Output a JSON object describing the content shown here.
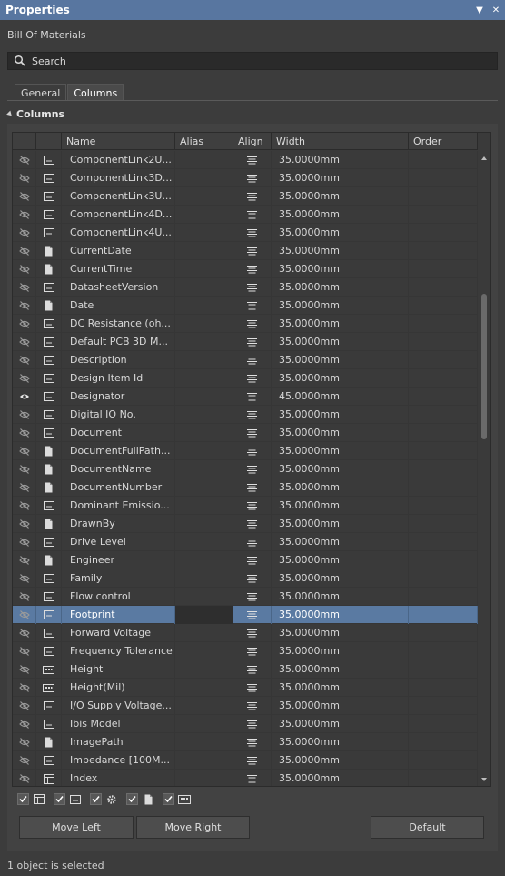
{
  "window": {
    "title": "Properties",
    "pin_glyph": "▼",
    "close_glyph": "✕"
  },
  "subject": "Bill Of Materials",
  "search": {
    "placeholder": "Search",
    "value": ""
  },
  "tabs": [
    {
      "label": "General",
      "active": false
    },
    {
      "label": "Columns",
      "active": true
    }
  ],
  "section": {
    "label": "Columns"
  },
  "table": {
    "headers": {
      "visible": "",
      "type": "",
      "name": "Name",
      "alias": "Alias",
      "align": "Align",
      "width": "Width",
      "order": "Order"
    },
    "rows": [
      {
        "name": "ComponentLink2U...",
        "alias": "",
        "width": "35.0000mm",
        "order": "",
        "visible": false,
        "type": "param",
        "selected": false
      },
      {
        "name": "ComponentLink3D...",
        "alias": "",
        "width": "35.0000mm",
        "order": "",
        "visible": false,
        "type": "param",
        "selected": false
      },
      {
        "name": "ComponentLink3U...",
        "alias": "",
        "width": "35.0000mm",
        "order": "",
        "visible": false,
        "type": "param",
        "selected": false
      },
      {
        "name": "ComponentLink4D...",
        "alias": "",
        "width": "35.0000mm",
        "order": "",
        "visible": false,
        "type": "param",
        "selected": false
      },
      {
        "name": "ComponentLink4U...",
        "alias": "",
        "width": "35.0000mm",
        "order": "",
        "visible": false,
        "type": "param",
        "selected": false
      },
      {
        "name": "CurrentDate",
        "alias": "",
        "width": "35.0000mm",
        "order": "",
        "visible": false,
        "type": "doc",
        "selected": false
      },
      {
        "name": "CurrentTime",
        "alias": "",
        "width": "35.0000mm",
        "order": "",
        "visible": false,
        "type": "doc",
        "selected": false
      },
      {
        "name": "DatasheetVersion",
        "alias": "",
        "width": "35.0000mm",
        "order": "",
        "visible": false,
        "type": "param",
        "selected": false
      },
      {
        "name": "Date",
        "alias": "",
        "width": "35.0000mm",
        "order": "",
        "visible": false,
        "type": "doc",
        "selected": false
      },
      {
        "name": "DC Resistance (oh...",
        "alias": "",
        "width": "35.0000mm",
        "order": "",
        "visible": false,
        "type": "param",
        "selected": false
      },
      {
        "name": "Default PCB 3D M...",
        "alias": "",
        "width": "35.0000mm",
        "order": "",
        "visible": false,
        "type": "param",
        "selected": false
      },
      {
        "name": "Description",
        "alias": "",
        "width": "35.0000mm",
        "order": "",
        "visible": false,
        "type": "param",
        "selected": false
      },
      {
        "name": "Design Item Id",
        "alias": "",
        "width": "35.0000mm",
        "order": "",
        "visible": false,
        "type": "param",
        "selected": false
      },
      {
        "name": "Designator",
        "alias": "",
        "width": "45.0000mm",
        "order": "",
        "visible": true,
        "type": "param",
        "selected": false
      },
      {
        "name": "Digital IO No.",
        "alias": "",
        "width": "35.0000mm",
        "order": "",
        "visible": false,
        "type": "param",
        "selected": false
      },
      {
        "name": "Document",
        "alias": "",
        "width": "35.0000mm",
        "order": "",
        "visible": false,
        "type": "param",
        "selected": false
      },
      {
        "name": "DocumentFullPath...",
        "alias": "",
        "width": "35.0000mm",
        "order": "",
        "visible": false,
        "type": "doc",
        "selected": false
      },
      {
        "name": "DocumentName",
        "alias": "",
        "width": "35.0000mm",
        "order": "",
        "visible": false,
        "type": "doc",
        "selected": false
      },
      {
        "name": "DocumentNumber",
        "alias": "",
        "width": "35.0000mm",
        "order": "",
        "visible": false,
        "type": "doc",
        "selected": false
      },
      {
        "name": "Dominant Emissio...",
        "alias": "",
        "width": "35.0000mm",
        "order": "",
        "visible": false,
        "type": "param",
        "selected": false
      },
      {
        "name": "DrawnBy",
        "alias": "",
        "width": "35.0000mm",
        "order": "",
        "visible": false,
        "type": "doc",
        "selected": false
      },
      {
        "name": "Drive Level",
        "alias": "",
        "width": "35.0000mm",
        "order": "",
        "visible": false,
        "type": "param",
        "selected": false
      },
      {
        "name": "Engineer",
        "alias": "",
        "width": "35.0000mm",
        "order": "",
        "visible": false,
        "type": "doc",
        "selected": false
      },
      {
        "name": "Family",
        "alias": "",
        "width": "35.0000mm",
        "order": "",
        "visible": false,
        "type": "param",
        "selected": false
      },
      {
        "name": "Flow control",
        "alias": "",
        "width": "35.0000mm",
        "order": "",
        "visible": false,
        "type": "param",
        "selected": false
      },
      {
        "name": "Footprint",
        "alias": "",
        "width": "35.0000mm",
        "order": "",
        "visible": false,
        "type": "param",
        "selected": true
      },
      {
        "name": "Forward Voltage",
        "alias": "",
        "width": "35.0000mm",
        "order": "",
        "visible": false,
        "type": "param",
        "selected": false
      },
      {
        "name": "Frequency Tolerance",
        "alias": "",
        "width": "35.0000mm",
        "order": "",
        "visible": false,
        "type": "param",
        "selected": false
      },
      {
        "name": "Height",
        "alias": "",
        "width": "35.0000mm",
        "order": "",
        "visible": false,
        "type": "pcb",
        "selected": false
      },
      {
        "name": "Height(Mil)",
        "alias": "",
        "width": "35.0000mm",
        "order": "",
        "visible": false,
        "type": "pcb",
        "selected": false
      },
      {
        "name": "I/O Supply Voltage...",
        "alias": "",
        "width": "35.0000mm",
        "order": "",
        "visible": false,
        "type": "param",
        "selected": false
      },
      {
        "name": "Ibis Model",
        "alias": "",
        "width": "35.0000mm",
        "order": "",
        "visible": false,
        "type": "param",
        "selected": false
      },
      {
        "name": "ImagePath",
        "alias": "",
        "width": "35.0000mm",
        "order": "",
        "visible": false,
        "type": "doc",
        "selected": false
      },
      {
        "name": "Impedance [100M...",
        "alias": "",
        "width": "35.0000mm",
        "order": "",
        "visible": false,
        "type": "param",
        "selected": false
      },
      {
        "name": "Index",
        "alias": "",
        "width": "35.0000mm",
        "order": "",
        "visible": false,
        "type": "table",
        "selected": false
      }
    ]
  },
  "filters": [
    {
      "name": "table-source",
      "checked": true
    },
    {
      "name": "parameter-source",
      "checked": true
    },
    {
      "name": "gear-source",
      "checked": true
    },
    {
      "name": "document-source",
      "checked": true
    },
    {
      "name": "pcb-source",
      "checked": true
    }
  ],
  "buttons": {
    "move_left": "Move Left",
    "move_right": "Move Right",
    "default": "Default"
  },
  "status": "1 object is selected",
  "colors": {
    "titlebar": "#5876a0",
    "selection": "#5a7aa2",
    "background": "#3c3c3c"
  }
}
